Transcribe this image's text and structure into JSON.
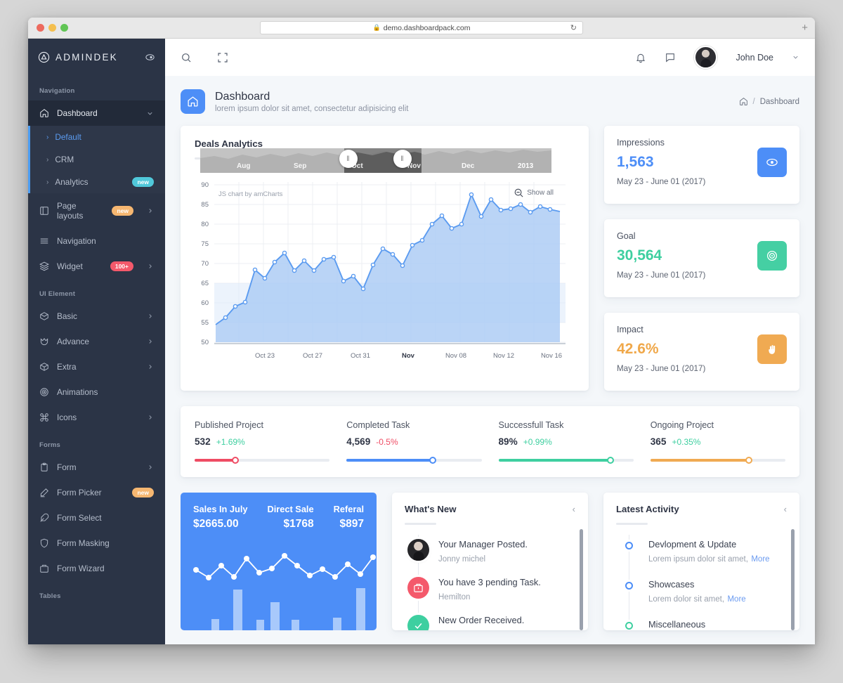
{
  "browser": {
    "url": "demo.dashboardpack.com",
    "lock_icon": "lock-icon",
    "reload_icon": "reload-icon",
    "newtab_label": "+"
  },
  "sidebar": {
    "brand": "ADMINDEK",
    "toggle_icon": "sidebar-toggle-icon",
    "sections": [
      {
        "label": "Navigation",
        "items": [
          {
            "label": "Dashboard",
            "icon": "home-icon",
            "active": true,
            "caret": "chevron-down-icon",
            "children": [
              {
                "label": "Default",
                "selected": true
              },
              {
                "label": "CRM",
                "selected": false
              },
              {
                "label": "Analytics",
                "selected": false,
                "badge": "new",
                "badge_color": "cyan"
              }
            ]
          },
          {
            "label": "Page layouts",
            "icon": "layout-icon",
            "badge": "new",
            "badge_color": "amber",
            "caret": "chevron-right-icon"
          },
          {
            "label": "Navigation",
            "icon": "menu-icon"
          },
          {
            "label": "Widget",
            "icon": "layers-icon",
            "badge": "100+",
            "badge_color": "pink",
            "caret": "chevron-right-icon"
          }
        ]
      },
      {
        "label": "UI Element",
        "items": [
          {
            "label": "Basic",
            "icon": "box-icon",
            "caret": "chevron-right-icon"
          },
          {
            "label": "Advance",
            "icon": "crown-icon",
            "caret": "chevron-right-icon"
          },
          {
            "label": "Extra",
            "icon": "package-icon",
            "caret": "chevron-right-icon"
          },
          {
            "label": "Animations",
            "icon": "target-icon"
          },
          {
            "label": "Icons",
            "icon": "command-icon",
            "caret": "chevron-right-icon"
          }
        ]
      },
      {
        "label": "Forms",
        "items": [
          {
            "label": "Form",
            "icon": "clipboard-icon",
            "caret": "chevron-right-icon"
          },
          {
            "label": "Form Picker",
            "icon": "pen-icon",
            "badge": "new",
            "badge_color": "amber"
          },
          {
            "label": "Form Select",
            "icon": "feather-icon"
          },
          {
            "label": "Form Masking",
            "icon": "shield-icon"
          },
          {
            "label": "Form Wizard",
            "icon": "briefcase-icon"
          }
        ]
      },
      {
        "label": "Tables",
        "items": []
      }
    ]
  },
  "topbar": {
    "search_icon": "search-icon",
    "fullscreen_icon": "fullscreen-icon",
    "bell_icon": "bell-icon",
    "chat_icon": "chat-icon",
    "avatar": "user-avatar",
    "user_name": "John Doe",
    "user_caret": "chevron-down-icon"
  },
  "page": {
    "icon": "home-icon",
    "title": "Dashboard",
    "subtitle": "lorem ipsum dolor sit amet, consectetur adipisicing elit",
    "breadcrumb": {
      "home_icon": "home-icon",
      "separator": "/",
      "current": "Dashboard"
    }
  },
  "deals": {
    "title": "Deals Analytics",
    "credit": "JS chart by amCharts",
    "show_all": "Show all",
    "zoom_out_icon": "zoom-out-icon",
    "scrollbar_labels": [
      "Aug",
      "Sep",
      "Oct",
      "Nov",
      "Dec",
      "2013"
    ],
    "scrollbar_bold_index": 5
  },
  "chart_data": {
    "type": "area",
    "title": "Deals Analytics",
    "xlabel": "",
    "ylabel": "",
    "ylim": [
      50,
      90
    ],
    "yticks": [
      50,
      55,
      60,
      65,
      70,
      75,
      80,
      85,
      90
    ],
    "grid": true,
    "legend": null,
    "xticks": [
      "Oct 23",
      "Oct 27",
      "Oct 31",
      "Nov",
      "Nov 08",
      "Nov 12",
      "Nov 16"
    ],
    "x": [
      "Oct 21",
      "Oct 22",
      "Oct 23",
      "Oct 24",
      "Oct 25",
      "Oct 26",
      "Oct 27",
      "Oct 28",
      "Oct 29",
      "Oct 30",
      "Oct 31",
      "Nov 01",
      "Nov 02",
      "Nov 03",
      "Nov 04",
      "Nov 05",
      "Nov 06",
      "Nov 07",
      "Nov 08",
      "Nov 09",
      "Nov 10",
      "Nov 11",
      "Nov 12",
      "Nov 13",
      "Nov 14",
      "Nov 15",
      "Nov 16",
      "Nov 17",
      "Nov 18",
      "Nov 19",
      "Nov 20",
      "Nov 21",
      "Nov 22",
      "Nov 23",
      "Nov 24"
    ],
    "values": [
      55.5,
      57.2,
      60.1,
      61.1,
      69.3,
      67.1,
      72.2,
      74.5,
      70.0,
      72.4,
      70.0,
      72.8,
      73.2,
      67.0,
      68.2,
      65.0,
      71.0,
      75.2,
      73.8,
      71.0,
      76.2,
      77.5,
      81.0,
      83.2,
      80.0,
      81.1,
      87.5,
      82.0,
      86.2,
      83.5,
      84.0,
      85.0,
      83.0,
      84.5,
      83.8
    ],
    "series_name": "Deals",
    "line_color": "#5b9bf0",
    "fill_color": "#aecdf5",
    "scrollbar_labels": [
      "Aug",
      "Sep",
      "Oct",
      "Nov",
      "Dec",
      "2013"
    ]
  },
  "kpis": [
    {
      "label": "Impressions",
      "value": "1,563",
      "range": "May 23 - June 01 (2017)",
      "color": "#4d8ef7",
      "icon": "eye-icon",
      "icon_bg": "#4d8ef7"
    },
    {
      "label": "Goal",
      "value": "30,564",
      "range": "May 23 - June 01 (2017)",
      "color": "#3ecfa0",
      "icon": "target-icon",
      "icon_bg": "#45cfa3"
    },
    {
      "label": "Impact",
      "value": "42.6%",
      "range": "May 23 - June 01 (2017)",
      "color": "#f0a84a",
      "icon": "hand-icon",
      "icon_bg": "#f0aa52"
    }
  ],
  "stats": [
    {
      "label": "Published Project",
      "value": "532",
      "delta": "+1.69%",
      "delta_color": "#3ecfa0",
      "percent": 30,
      "color": "#ef4c64"
    },
    {
      "label": "Completed Task",
      "value": "4,569",
      "delta": "-0.5%",
      "delta_color": "#ef4c64",
      "percent": 64,
      "color": "#4d8ef7"
    },
    {
      "label": "Successfull Task",
      "value": "89%",
      "delta": "+0.99%",
      "delta_color": "#3ecfa0",
      "percent": 83,
      "color": "#3ecfa0"
    },
    {
      "label": "Ongoing Project",
      "value": "365",
      "delta": "+0.35%",
      "delta_color": "#3ecfa0",
      "percent": 73,
      "color": "#f0aa52"
    }
  ],
  "sales": {
    "title": "Sales In July",
    "amount": "$2665.00",
    "direct_label": "Direct Sale",
    "direct_value": "$1768",
    "referal_label": "Referal",
    "referal_value": "$897",
    "line_points": [
      50,
      62,
      44,
      64,
      38,
      48,
      52,
      40,
      58,
      46,
      60,
      42,
      54,
      38
    ],
    "bars": [
      0,
      0,
      12,
      0,
      52,
      0,
      10,
      34,
      10,
      0,
      0,
      12,
      0,
      50
    ]
  },
  "whats_new": {
    "title": "What's New",
    "collapse_icon": "chevron-left-icon",
    "items": [
      {
        "title": "Your Manager Posted.",
        "sub": "Jonny michel",
        "icon": "user-photo",
        "icon_bg": "photo"
      },
      {
        "title": "You have 3 pending Task.",
        "sub": "Hemilton",
        "icon": "briefcase-icon",
        "icon_bg": "#f4596b"
      },
      {
        "title": "New Order Received.",
        "sub": "",
        "icon": "check-icon",
        "icon_bg": "#3ecfa0"
      }
    ]
  },
  "latest_activity": {
    "title": "Latest Activity",
    "collapse_icon": "chevron-left-icon",
    "items": [
      {
        "title": "Devlopment & Update",
        "sub": "Lorem ipsum dolor sit amet,",
        "more": "More",
        "dot_color": "#4d8ef7"
      },
      {
        "title": "Showcases",
        "sub": "Lorem dolor sit amet,",
        "more": "More",
        "dot_color": "#4d8ef7"
      },
      {
        "title": "Miscellaneous",
        "sub": "",
        "more": "",
        "dot_color": "#3ecfa0"
      }
    ]
  }
}
